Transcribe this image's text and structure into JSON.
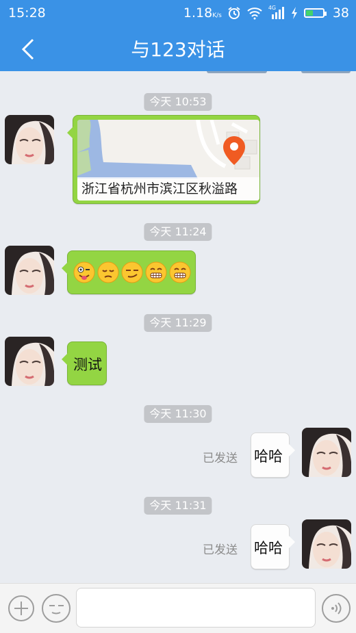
{
  "status_bar": {
    "time": "15:28",
    "network_speed": "1.18",
    "network_speed_unit": "K/s",
    "signal_label": "4G",
    "battery_level": "38",
    "icons": [
      "alarm-icon",
      "wifi-icon",
      "signal-icon",
      "charging-icon",
      "battery-icon"
    ]
  },
  "header": {
    "title": "与123对话",
    "back_icon": "back-arrow-icon"
  },
  "messages": [
    {
      "timestamp": "今天 10:53",
      "side": "left",
      "type": "location",
      "address": "浙江省杭州市滨江区秋溢路"
    },
    {
      "timestamp": "今天 11:24",
      "side": "left",
      "type": "emoji",
      "emojis": [
        "winking-tongue-emoji",
        "pensive-emoji",
        "smirk-emoji",
        "grinning-teeth-emoji",
        "grinning-teeth-emoji"
      ]
    },
    {
      "timestamp": "今天 11:29",
      "side": "left",
      "type": "text",
      "text": "测试"
    },
    {
      "timestamp": "今天 11:30",
      "side": "right",
      "type": "text",
      "text": "哈哈",
      "status": "已发送"
    },
    {
      "timestamp": "今天 11:31",
      "side": "right",
      "type": "text",
      "text": "哈哈",
      "status": "已发送"
    }
  ],
  "input_bar": {
    "plus_icon": "plus-icon",
    "emoji_icon": "emoji-face-icon",
    "input_value": "",
    "voice_icon": "voice-icon"
  },
  "colors": {
    "header": "#3a92e6",
    "incoming_bubble": "#93d543",
    "outgoing_bubble": "#fdfdfd",
    "chat_background": "#e9ecf1",
    "map_pin": "#f05b22"
  }
}
